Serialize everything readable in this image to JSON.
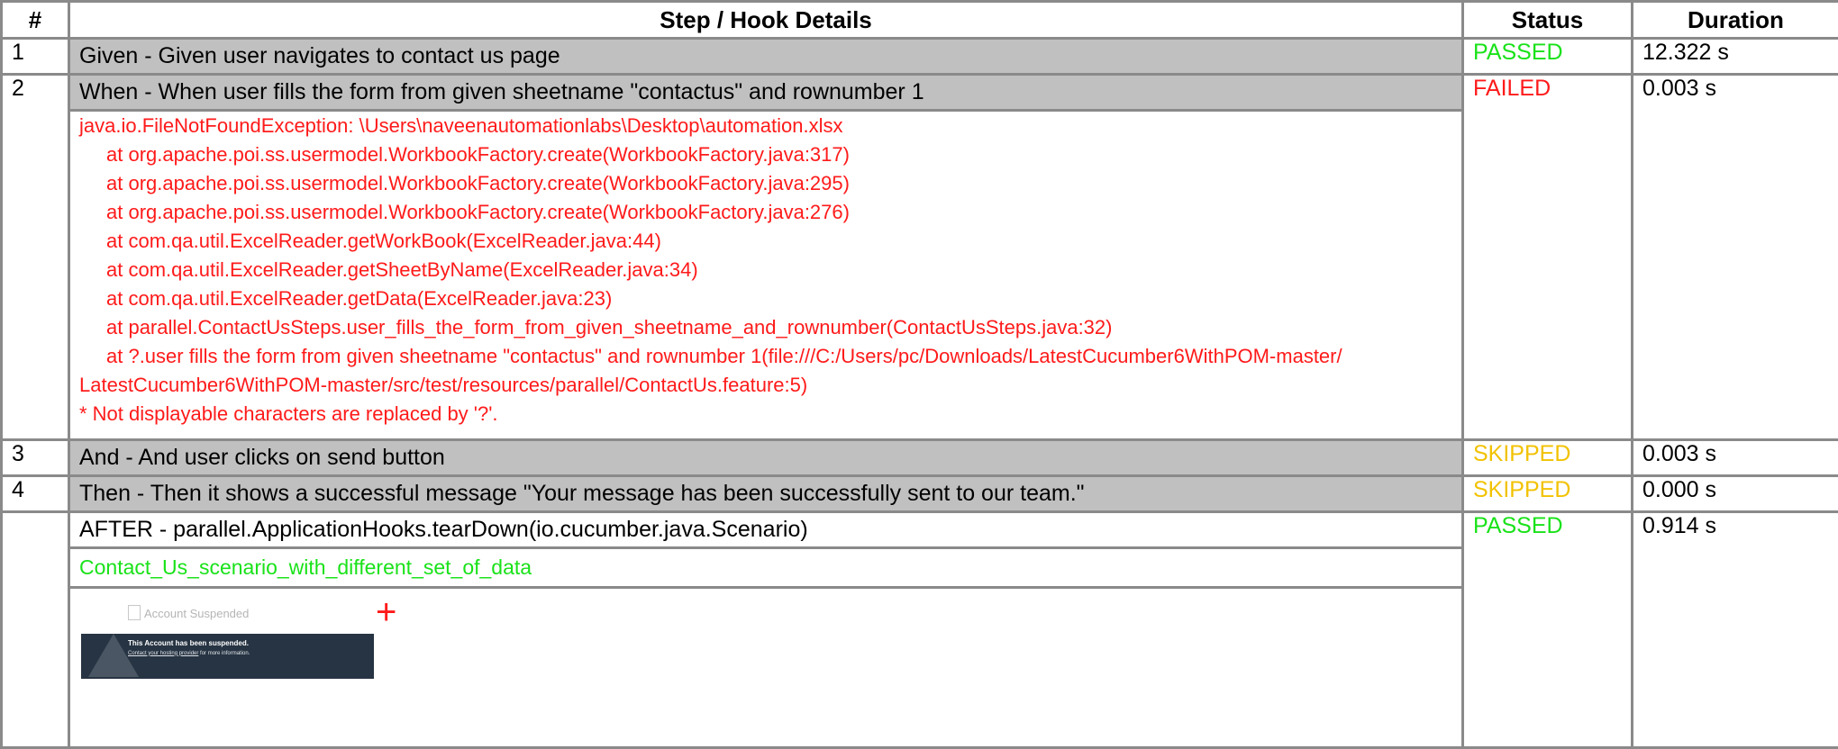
{
  "header": {
    "num": "#",
    "details": "Step / Hook Details",
    "status": "Status",
    "duration": "Duration"
  },
  "colors": {
    "passed": "#19e219",
    "failed": "#ff1a1a",
    "skipped": "#f2c200",
    "step_bg": "#c0c0c0"
  },
  "steps": [
    {
      "num": "1",
      "text": "Given - Given user navigates to contact us page",
      "status": "PASSED",
      "duration": "12.322 s"
    },
    {
      "num": "2",
      "text": "When - When user fills the form from given sheetname \"contactus\" and rownumber 1",
      "status": "FAILED",
      "duration": "0.003 s"
    },
    {
      "num": "3",
      "text": "And - And user clicks on send button",
      "status": "SKIPPED",
      "duration": "0.003 s"
    },
    {
      "num": "4",
      "text": "Then - Then it shows a successful message \"Your message has been successfully sent to our team.\"",
      "status": "SKIPPED",
      "duration": "0.000 s"
    }
  ],
  "trace": [
    "java.io.FileNotFoundException: \\Users\\naveenautomationlabs\\Desktop\\automation.xlsx",
    "at org.apache.poi.ss.usermodel.WorkbookFactory.create(WorkbookFactory.java:317)",
    "at org.apache.poi.ss.usermodel.WorkbookFactory.create(WorkbookFactory.java:295)",
    "at org.apache.poi.ss.usermodel.WorkbookFactory.create(WorkbookFactory.java:276)",
    "at com.qa.util.ExcelReader.getWorkBook(ExcelReader.java:44)",
    "at com.qa.util.ExcelReader.getSheetByName(ExcelReader.java:34)",
    "at com.qa.util.ExcelReader.getData(ExcelReader.java:23)",
    "at parallel.ContactUsSteps.user_fills_the_form_from_given_sheetname_and_rownumber(ContactUsSteps.java:32)",
    "at ?.user fills the form from given sheetname \"contactus\" and rownumber 1(file:///C:/Users/pc/Downloads/LatestCucumber6WithPOM-master/",
    "LatestCucumber6WithPOM-master/src/test/resources/parallel/ContactUs.feature:5)",
    "* Not displayable characters are replaced by '?'."
  ],
  "hook": {
    "text": "AFTER - parallel.ApplicationHooks.tearDown(io.cucumber.java.Scenario)",
    "status": "PASSED",
    "duration": "0.914 s",
    "output": "Contact_Us_scenario_with_different_set_of_data",
    "screenshot": {
      "title": "Account Suspended",
      "heading": "This Account has been suspended.",
      "link": "Contact your hosting provider",
      "rest": " for more information.",
      "expand_icon": "plus-icon"
    }
  }
}
